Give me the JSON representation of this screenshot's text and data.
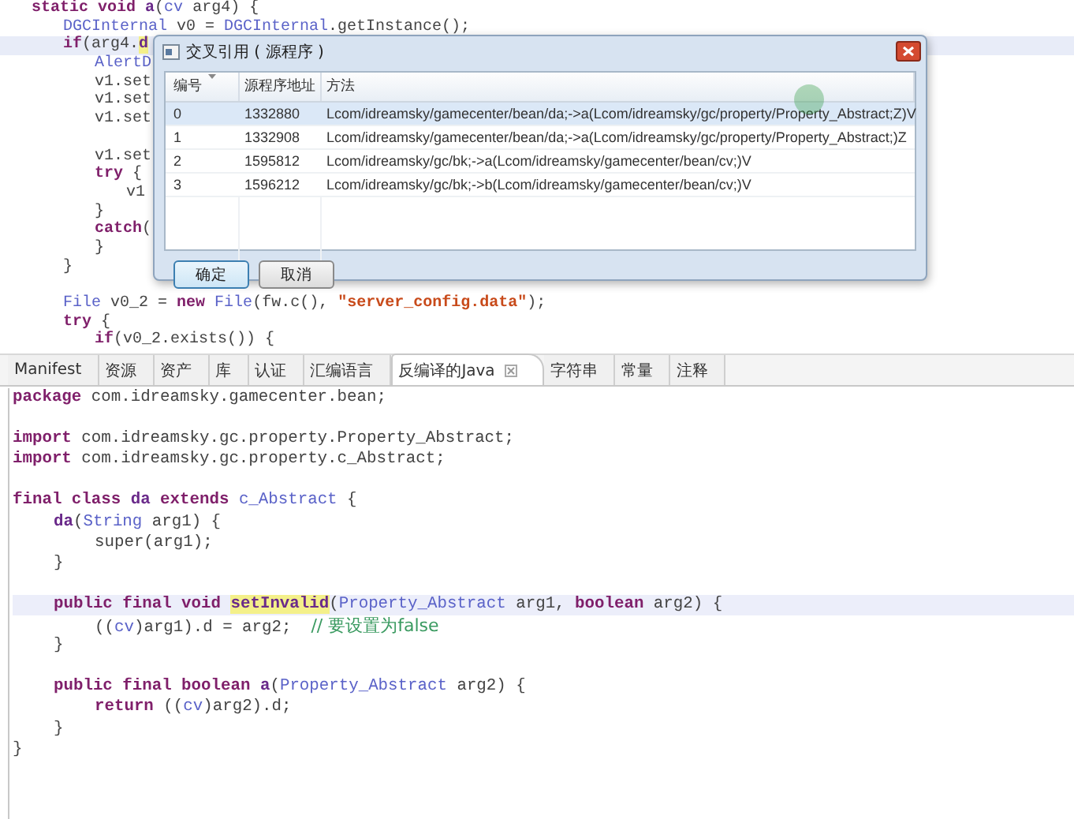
{
  "top_editor": {
    "lines": [
      {
        "current": false,
        "tokens": [
          {
            "text": "\tstatic void ",
            "kind": "kw"
          },
          {
            "text": "a",
            "kind": "name"
          },
          {
            "text": "(",
            "kind": "plain"
          },
          {
            "text": "cv",
            "kind": "type"
          },
          {
            "text": " arg4) {",
            "kind": "plain"
          }
        ]
      },
      {
        "current": false,
        "tokens": [
          {
            "text": "\t\tDGCInternal",
            "kind": "type"
          },
          {
            "text": " v0 = ",
            "kind": "plain"
          },
          {
            "text": "DGCInternal",
            "kind": "type"
          },
          {
            "text": ".getInstance();",
            "kind": "plain"
          }
        ]
      },
      {
        "current": true,
        "tokens": [
          {
            "text": "\t\tif",
            "kind": "kw"
          },
          {
            "text": "(arg4.",
            "kind": "plain"
          },
          {
            "text": "d",
            "kind": "match"
          }
        ]
      },
      {
        "current": false,
        "tokens": [
          {
            "text": "\t\t\tAlertD",
            "kind": "type"
          }
        ]
      },
      {
        "current": false,
        "tokens": [
          {
            "text": "\t\t\tv1.set",
            "kind": "plain"
          }
        ]
      },
      {
        "current": false,
        "tokens": [
          {
            "text": "\t\t\tv1.set",
            "kind": "plain"
          }
        ]
      },
      {
        "current": false,
        "tokens": [
          {
            "text": "\t\t\tv1.set",
            "kind": "plain"
          }
        ]
      },
      {
        "current": false
      },
      {
        "current": false,
        "tokens": [
          {
            "text": "\t\t\tv1.set",
            "kind": "plain"
          }
        ]
      },
      {
        "current": false,
        "tokens": [
          {
            "text": "\t\t\ttry",
            "kind": "kw"
          },
          {
            "text": " {",
            "kind": "plain"
          }
        ]
      },
      {
        "current": false,
        "tokens": [
          {
            "text": "\t\t\t\tv1",
            "kind": "plain"
          }
        ]
      },
      {
        "current": false,
        "tokens": [
          {
            "text": "\t\t\t}",
            "kind": "plain"
          }
        ]
      },
      {
        "current": false,
        "tokens": [
          {
            "text": "\t\t\tcatch",
            "kind": "kw"
          },
          {
            "text": "(",
            "kind": "plain"
          }
        ]
      },
      {
        "current": false,
        "tokens": [
          {
            "text": "\t\t\t}",
            "kind": "plain"
          }
        ]
      },
      {
        "current": false,
        "tokens": [
          {
            "text": "\t\t}",
            "kind": "plain"
          }
        ]
      },
      {
        "current": false
      },
      {
        "current": false,
        "tokens": [
          {
            "text": "\t\tFile",
            "kind": "type"
          },
          {
            "text": " v0_2 = ",
            "kind": "plain"
          },
          {
            "text": "new ",
            "kind": "kw"
          },
          {
            "text": "File",
            "kind": "type"
          },
          {
            "text": "(fw.c(), ",
            "kind": "plain"
          },
          {
            "text": "\"server_config.data\"",
            "kind": "str"
          },
          {
            "text": ");",
            "kind": "plain"
          }
        ]
      },
      {
        "current": false,
        "tokens": [
          {
            "text": "\t\ttry",
            "kind": "kw"
          },
          {
            "text": " {",
            "kind": "plain"
          }
        ]
      },
      {
        "current": false,
        "tokens": [
          {
            "text": "\t\t\tif",
            "kind": "kw"
          },
          {
            "text": "(v0_2.exists()) {",
            "kind": "plain"
          }
        ]
      }
    ]
  },
  "dialog": {
    "title": "交叉引用 ( 源程序 )",
    "columns": [
      "编号",
      "源程序地址",
      "方法"
    ],
    "rows": [
      {
        "selected": true,
        "cells": [
          "0",
          "1332880",
          "Lcom/idreamsky/gamecenter/bean/da;->a(Lcom/idreamsky/gc/property/Property_Abstract;Z)V"
        ]
      },
      {
        "selected": false,
        "cells": [
          "1",
          "1332908",
          "Lcom/idreamsky/gamecenter/bean/da;->a(Lcom/idreamsky/gc/property/Property_Abstract;)Z"
        ]
      },
      {
        "selected": false,
        "cells": [
          "2",
          "1595812",
          "Lcom/idreamsky/gc/bk;->a(Lcom/idreamsky/gamecenter/bean/cv;)V"
        ]
      },
      {
        "selected": false,
        "cells": [
          "3",
          "1596212",
          "Lcom/idreamsky/gc/bk;->b(Lcom/idreamsky/gamecenter/bean/cv;)V"
        ]
      }
    ],
    "buttons": [
      {
        "label": "确定",
        "default": true
      },
      {
        "label": "取消",
        "default": false
      }
    ]
  },
  "tabs": [
    {
      "label": "Manifest",
      "selected": false
    },
    {
      "label": "资源",
      "selected": false
    },
    {
      "label": "资产",
      "selected": false
    },
    {
      "label": "库",
      "selected": false
    },
    {
      "label": "认证",
      "selected": false
    },
    {
      "label": "汇编语言",
      "selected": false
    },
    {
      "label": "反编译的Java",
      "selected": true
    },
    {
      "label": "字符串",
      "selected": false
    },
    {
      "label": "常量",
      "selected": false
    },
    {
      "label": "注释",
      "selected": false
    }
  ],
  "bottom_editor": {
    "lines": [
      {
        "current": false,
        "tokens": [
          {
            "text": "package",
            "kind": "kw"
          },
          {
            "text": " com.idreamsky.gamecenter.bean;",
            "kind": "plain"
          }
        ]
      },
      {
        "current": false
      },
      {
        "current": false,
        "tokens": [
          {
            "text": "import",
            "kind": "kw"
          },
          {
            "text": " com.idreamsky.gc.property.Property_Abstract;",
            "kind": "plain"
          }
        ]
      },
      {
        "current": false,
        "tokens": [
          {
            "text": "import",
            "kind": "kw"
          },
          {
            "text": " com.idreamsky.gc.property.c_Abstract;",
            "kind": "plain"
          }
        ]
      },
      {
        "current": false
      },
      {
        "current": false,
        "tokens": [
          {
            "text": "final class ",
            "kind": "kw"
          },
          {
            "text": "da ",
            "kind": "name"
          },
          {
            "text": "extends ",
            "kind": "kw"
          },
          {
            "text": "c_Abstract",
            "kind": "type"
          },
          {
            "text": " {",
            "kind": "plain"
          }
        ]
      },
      {
        "current": false,
        "tokens": [
          {
            "text": "\tda",
            "kind": "name"
          },
          {
            "text": "(",
            "kind": "plain"
          },
          {
            "text": "String",
            "kind": "type"
          },
          {
            "text": " arg1) {",
            "kind": "plain"
          }
        ]
      },
      {
        "current": false,
        "tokens": [
          {
            "text": "\t\tsuper(arg1);",
            "kind": "plain"
          }
        ]
      },
      {
        "current": false,
        "tokens": [
          {
            "text": "\t}",
            "kind": "plain"
          }
        ]
      },
      {
        "current": false
      },
      {
        "current": true,
        "tokens": [
          {
            "text": "\tpublic final void ",
            "kind": "kw"
          },
          {
            "text": "setInvalid",
            "kind": "match"
          },
          {
            "text": "(",
            "kind": "plain"
          },
          {
            "text": "Property_Abstract",
            "kind": "type"
          },
          {
            "text": " arg1, ",
            "kind": "plain"
          },
          {
            "text": "boolean",
            "kind": "kw"
          },
          {
            "text": " arg2) {",
            "kind": "plain"
          }
        ]
      },
      {
        "current": false,
        "tokens": [
          {
            "text": "\t\t((",
            "kind": "plain"
          },
          {
            "text": "cv",
            "kind": "type"
          },
          {
            "text": ")arg1).d = arg2;  ",
            "kind": "plain"
          },
          {
            "text": "// 要设置为false",
            "kind": "comment"
          }
        ]
      },
      {
        "current": false,
        "tokens": [
          {
            "text": "\t}",
            "kind": "plain"
          }
        ]
      },
      {
        "current": false
      },
      {
        "current": false,
        "tokens": [
          {
            "text": "\tpublic final boolean ",
            "kind": "kw"
          },
          {
            "text": "a",
            "kind": "name"
          },
          {
            "text": "(",
            "kind": "plain"
          },
          {
            "text": "Property_Abstract",
            "kind": "type"
          },
          {
            "text": " arg2) {",
            "kind": "plain"
          }
        ]
      },
      {
        "current": false,
        "tokens": [
          {
            "text": "\t\treturn",
            "kind": "kw"
          },
          {
            "text": " ((",
            "kind": "plain"
          },
          {
            "text": "cv",
            "kind": "type"
          },
          {
            "text": ")arg2).d;",
            "kind": "plain"
          }
        ]
      },
      {
        "current": false,
        "tokens": [
          {
            "text": "\t}",
            "kind": "plain"
          }
        ]
      },
      {
        "current": false,
        "tokens": [
          {
            "text": "}",
            "kind": "plain"
          }
        ]
      }
    ]
  }
}
